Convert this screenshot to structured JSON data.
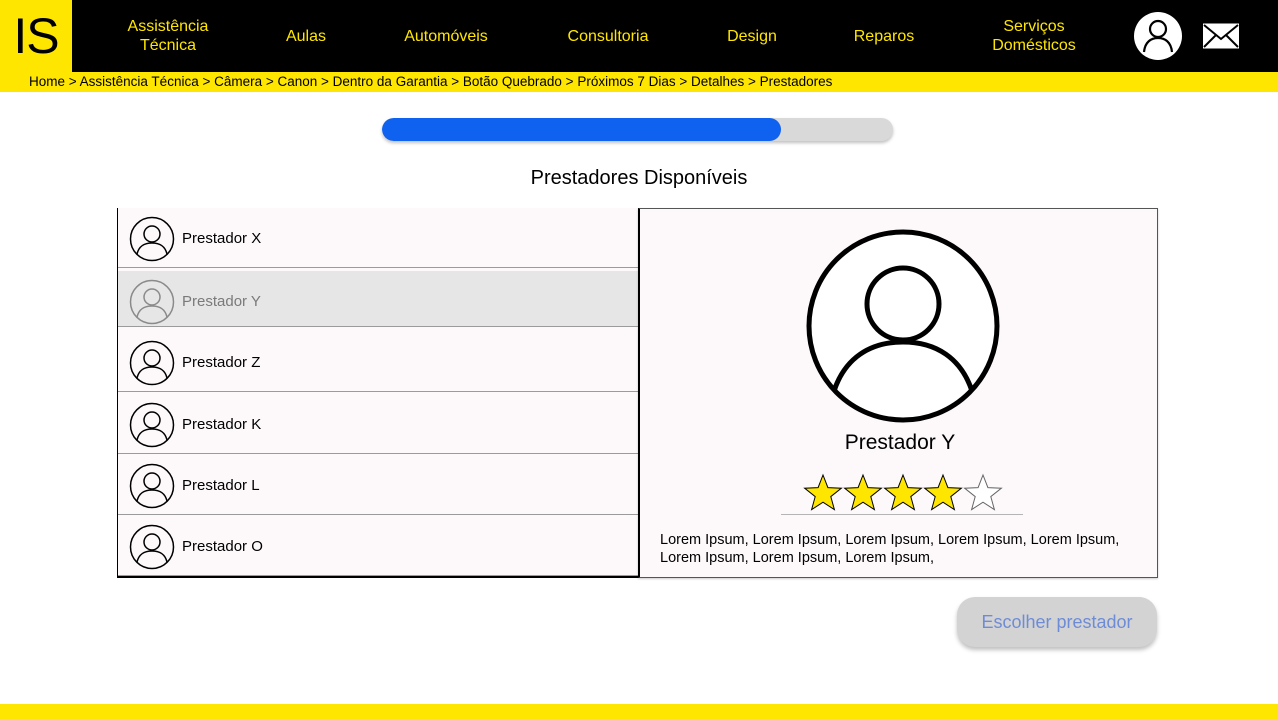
{
  "header": {
    "logo": "IS",
    "nav": [
      {
        "label": "Assistência\nTécnica"
      },
      {
        "label": "Aulas"
      },
      {
        "label": "Automóveis"
      },
      {
        "label": "Consultoria"
      },
      {
        "label": "Design"
      },
      {
        "label": "Reparos"
      },
      {
        "label": "Serviços\nDomésticos"
      }
    ],
    "user_icon": "user-icon",
    "mail_icon": "mail-icon"
  },
  "breadcrumb": "Home > Assistência Técnica > Câmera > Canon > Dentro da Garantia > Botão Quebrado > Próximos 7 Dias > Detalhes > Prestadores",
  "progress": {
    "value": 0.78
  },
  "title": "Prestadores Disponíveis",
  "providers": [
    {
      "name": "Prestador X",
      "selected": false
    },
    {
      "name": "Prestador Y",
      "selected": true
    },
    {
      "name": "Prestador Z",
      "selected": false
    },
    {
      "name": "Prestador K",
      "selected": false
    },
    {
      "name": "Prestador L",
      "selected": false
    },
    {
      "name": "Prestador O",
      "selected": false
    }
  ],
  "detail": {
    "name": "Prestador Y",
    "rating": 4,
    "rating_max": 5,
    "description": "Lorem Ipsum, Lorem Ipsum, Lorem Ipsum, Lorem Ipsum, Lorem Ipsum, Lorem Ipsum, Lorem Ipsum, Lorem Ipsum,"
  },
  "choose_button": "Escolher prestador",
  "colors": {
    "accent": "#FFE600",
    "header_bg": "#000000",
    "progress": "#0f62f0",
    "star": "#FFE600"
  }
}
